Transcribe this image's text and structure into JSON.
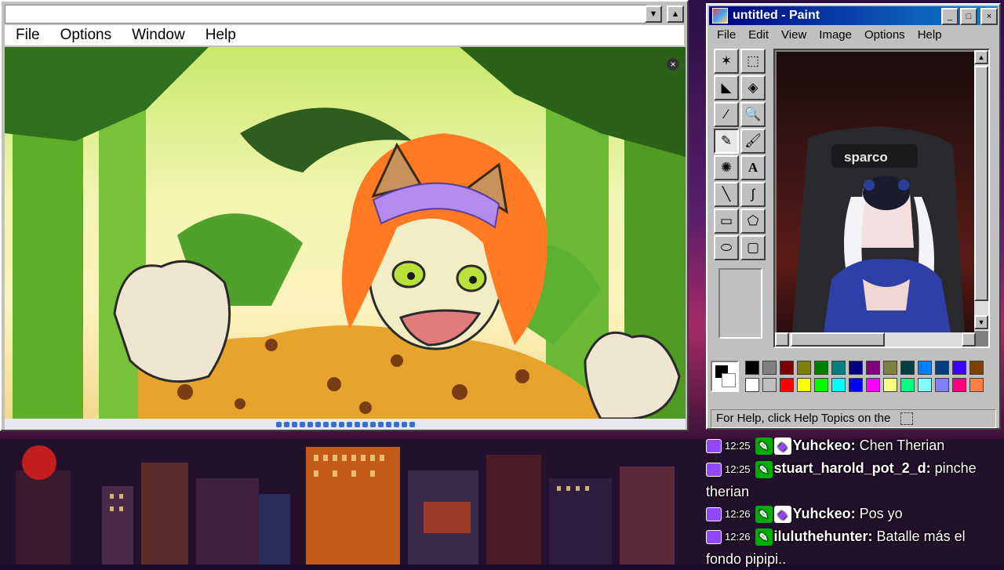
{
  "left_window": {
    "menu": [
      "File",
      "Options",
      "Window",
      "Help"
    ],
    "scroll_down_glyph": "▼",
    "scroll_up_glyph": "▲",
    "close_glyph": "×"
  },
  "paint": {
    "title": "untitled - Paint",
    "controls": [
      "_",
      "□",
      "×"
    ],
    "menu": [
      "File",
      "Edit",
      "View",
      "Image",
      "Options",
      "Help"
    ],
    "tools": [
      "star-select",
      "rect-select",
      "eraser",
      "fill",
      "picker",
      "magnifier",
      "pencil",
      "brush",
      "airbrush",
      "text",
      "line",
      "curve",
      "rectangle",
      "polygon",
      "ellipse",
      "rounded-rect"
    ],
    "tool_glyphs": [
      "✶",
      "⬚",
      "◣",
      "◈",
      "⁄",
      "🔍",
      "✎",
      "🖌",
      "✺",
      "A",
      "╲",
      "∫",
      "▭",
      "⬠",
      "⬭",
      "▢"
    ],
    "palette_top": [
      "#000000",
      "#808080",
      "#800000",
      "#808000",
      "#008000",
      "#008080",
      "#000080",
      "#800080",
      "#808040",
      "#004040",
      "#0080ff",
      "#004080",
      "#4000ff",
      "#804000"
    ],
    "palette_bottom": [
      "#ffffff",
      "#c0c0c0",
      "#ff0000",
      "#ffff00",
      "#00ff00",
      "#00ffff",
      "#0000ff",
      "#ff00ff",
      "#ffff80",
      "#00ff80",
      "#80ffff",
      "#8080ff",
      "#ff0080",
      "#ff8040"
    ],
    "canvas_text": "sparco",
    "status": "For Help, click Help Topics on the"
  },
  "chat": [
    {
      "time": "12:25",
      "user": "Yuhckeo:",
      "text": "Chen Therian",
      "user_color": "#ffffff",
      "badges": [
        "green",
        "purple"
      ]
    },
    {
      "time": "12:25",
      "user": "stuart_harold_pot_2_d:",
      "text": "pinche therian",
      "user_color": "#ffffff",
      "badges": [
        "green"
      ]
    },
    {
      "time": "12:26",
      "user": "Yuhckeo:",
      "text": "Pos yo",
      "user_color": "#ffffff",
      "badges": [
        "green",
        "purple"
      ]
    },
    {
      "time": "12:26",
      "user": "iluluthehunter:",
      "text": "Batalle más el fondo pipipi..",
      "user_color": "#ffffff",
      "badges": [
        "green"
      ]
    }
  ]
}
